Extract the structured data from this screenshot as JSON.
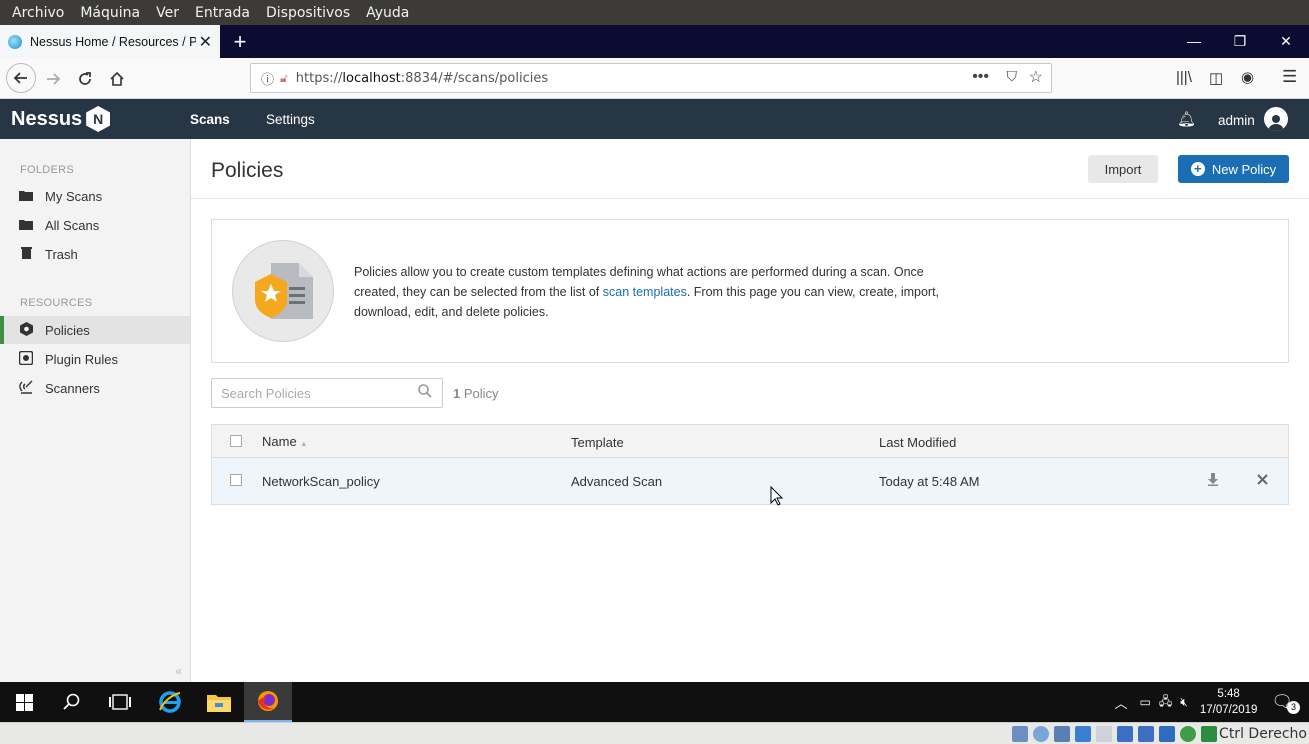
{
  "vbox_menu": [
    "Archivo",
    "Máquina",
    "Ver",
    "Entrada",
    "Dispositivos",
    "Ayuda"
  ],
  "browser": {
    "tab_title": "Nessus Home / Resources / Po",
    "url_prefix": "https://",
    "url_host": "localhost",
    "url_path": ":8834/#/scans/policies"
  },
  "app": {
    "logo": "Nessus",
    "logo_badge": "N",
    "nav": {
      "scans": "Scans",
      "settings": "Settings"
    },
    "user": "admin"
  },
  "sidebar": {
    "folders_heading": "FOLDERS",
    "folders": [
      {
        "label": "My Scans",
        "icon": "folder-icon"
      },
      {
        "label": "All Scans",
        "icon": "folder-icon"
      },
      {
        "label": "Trash",
        "icon": "trash-icon"
      }
    ],
    "resources_heading": "RESOURCES",
    "resources": [
      {
        "label": "Policies",
        "icon": "policy-shield-icon",
        "active": true
      },
      {
        "label": "Plugin Rules",
        "icon": "plugin-rules-icon"
      },
      {
        "label": "Scanners",
        "icon": "scanner-icon"
      }
    ]
  },
  "page": {
    "title": "Policies",
    "import_label": "Import",
    "new_policy_label": "New Policy",
    "info_text_1": "Policies allow you to create custom templates defining what actions are performed during a scan. Once created, they can be selected from the list of ",
    "info_link": "scan templates",
    "info_text_2": ". From this page you can view, create, import, download, edit, and delete policies.",
    "search_placeholder": "Search Policies",
    "count_num": "1",
    "count_label": "Policy"
  },
  "table": {
    "columns": [
      "Name",
      "Template",
      "Last Modified"
    ],
    "sort_indicator": "▲",
    "rows": [
      {
        "name": "NetworkScan_policy",
        "template": "Advanced Scan",
        "modified": "Today at 5:48 AM"
      }
    ]
  },
  "taskbar": {
    "time": "5:48",
    "date": "17/07/2019",
    "notifications": "3"
  },
  "vbox_status": {
    "host_key": "Ctrl Derecho"
  },
  "colors": {
    "header": "#263645",
    "accent": "#1b6eb4",
    "active_marker": "#3d8f3d"
  }
}
